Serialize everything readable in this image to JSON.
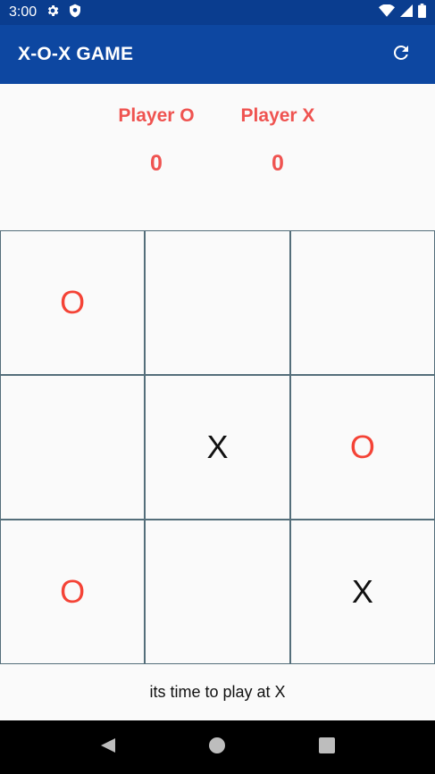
{
  "status_bar": {
    "time": "3:00",
    "icons": [
      "gear-icon",
      "shield-icon",
      "wifi-icon",
      "signal-icon",
      "battery-icon"
    ]
  },
  "app_bar": {
    "title": "X-O-X GAME",
    "action_icon": "refresh-icon"
  },
  "scoreboard": {
    "players": [
      {
        "name": "Player O",
        "score": "0"
      },
      {
        "name": "Player X",
        "score": "0"
      }
    ],
    "color": "#ef5350"
  },
  "board": {
    "cells": [
      "O",
      "",
      "",
      "",
      "X",
      "O",
      "O",
      "",
      "X"
    ],
    "colors": {
      "O": "#f44336",
      "X": "#111111"
    }
  },
  "message": "its time to play at X",
  "nav_bar": {
    "icons": [
      "back-icon",
      "home-icon",
      "recents-icon"
    ]
  }
}
